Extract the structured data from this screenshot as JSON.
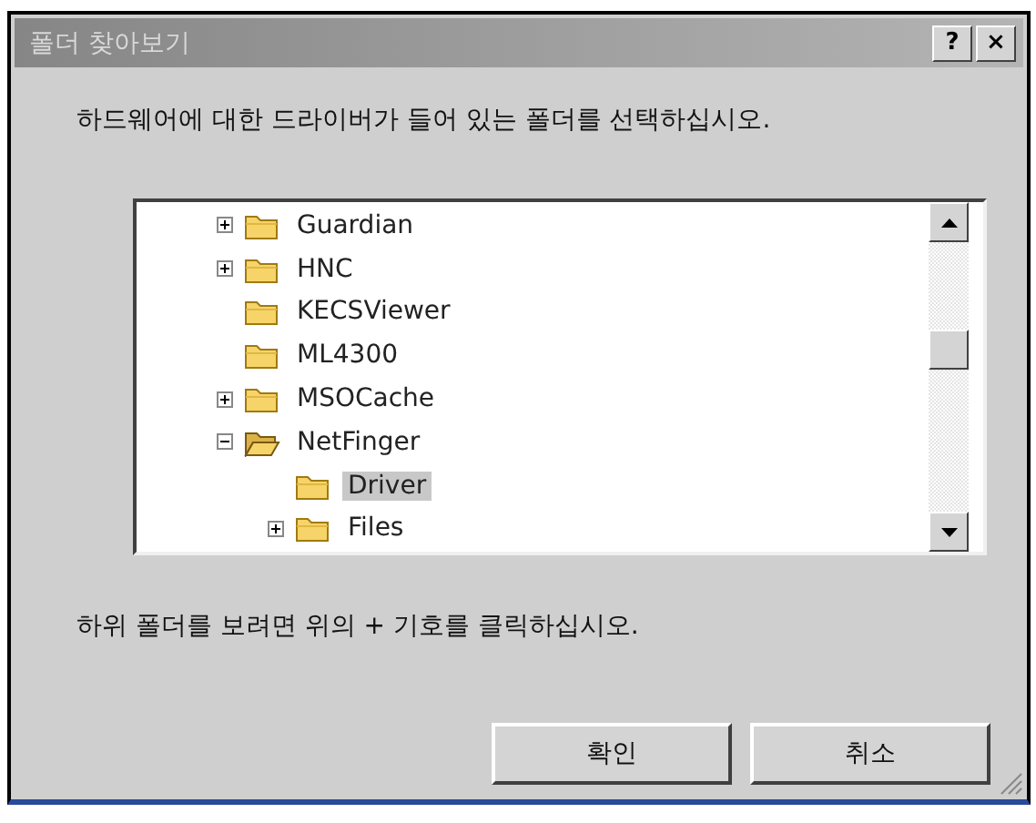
{
  "window": {
    "title": "폴더 찾아보기",
    "title_buttons": [
      "?",
      "×"
    ]
  },
  "message": "하드웨어에 대한 드라이버가 들어 있는 폴더를 선택하십시오.",
  "tree": [
    {
      "label": "Guardian",
      "expandable": true,
      "expanded": false,
      "selected": false
    },
    {
      "label": "HNC",
      "expandable": true,
      "expanded": false,
      "selected": false
    },
    {
      "label": "KECSViewer",
      "expandable": false,
      "expanded": false,
      "selected": false
    },
    {
      "label": "ML4300",
      "expandable": false,
      "expanded": false,
      "selected": false
    },
    {
      "label": "MSOCache",
      "expandable": true,
      "expanded": false,
      "selected": false
    },
    {
      "label": "NetFinger",
      "expandable": true,
      "expanded": true,
      "selected": false,
      "children": [
        {
          "label": "Driver",
          "expandable": false,
          "expanded": false,
          "selected": true
        },
        {
          "label": "Files",
          "expandable": true,
          "expanded": false,
          "selected": false
        }
      ]
    }
  ],
  "hint": "하위 폴더를 보려면 위의 + 기호를 클릭하십시오.",
  "buttons": [
    "확인",
    "취소"
  ]
}
